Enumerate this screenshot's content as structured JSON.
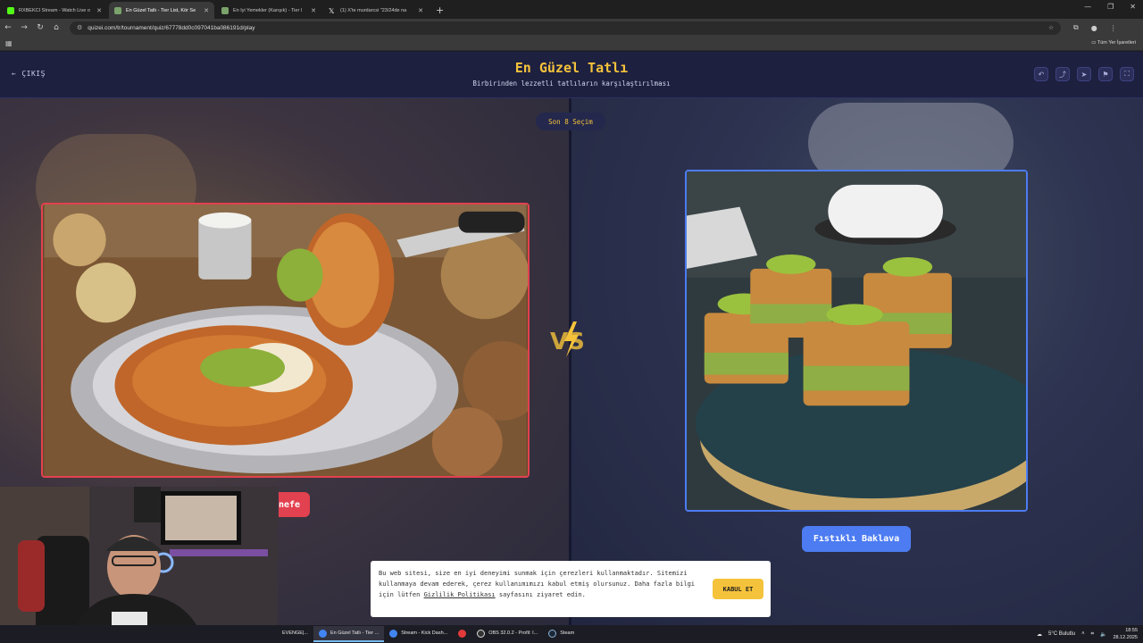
{
  "browser": {
    "tabs": [
      {
        "title": "RXBEKCI Stream - Watch Live o",
        "active": false,
        "favicon_color": "#53fc18"
      },
      {
        "title": "En Güzel Tatlı - Tier List, Kör Se",
        "active": true,
        "favicon_color": "#7aa36b"
      },
      {
        "title": "En İyi Yemekler (Karışık) - Tier l",
        "active": false,
        "favicon_color": "#7aa36b"
      },
      {
        "title": "(1) X'te murdarcsi \"23/24de na",
        "active": false,
        "favicon_color": "#ffffff"
      }
    ],
    "url": "quizei.com/tr/tournament/quiz/67778dd0c097041ba086191d/play",
    "bookmarks_all": "Tüm Yer İşaretleri"
  },
  "header": {
    "exit_label": "ÇIKIŞ",
    "title": "En Güzel Tatlı",
    "subtitle": "Birbirinden lezzetli tatlıların karşılaştırılması",
    "icons": [
      "undo-icon",
      "share-icon",
      "send-icon",
      "flag-icon",
      "fullscreen-icon"
    ]
  },
  "arena": {
    "round_label": "Son 8 Seçim",
    "left": {
      "name": "nefe",
      "accent": "#e2414f"
    },
    "right": {
      "name": "Fıstıklı Baklava",
      "accent": "#4d7cf2"
    }
  },
  "cookie": {
    "text_before": "Bu web sitesi, size en iyi deneyimi sunmak için çerezleri kullanmaktadır. Sitemizi kullanmaya devam ederek, çerez kullanımımızı kabul etmiş olursunuz. Daha fazla bilgi için lütfen ",
    "link": "Gizlilik Politikası",
    "text_after": " sayfasını ziyaret edin.",
    "button": "KABUL ET"
  },
  "taskbar": {
    "items": [
      {
        "label": "EVENGE|...",
        "active": false,
        "color": "#555"
      },
      {
        "label": "En Güzel Tatlı - Tier ...",
        "active": true,
        "color": "#4285f4"
      },
      {
        "label": "Stream - Kick Dash...",
        "active": false,
        "color": "#4285f4"
      },
      {
        "label": "",
        "active": false,
        "color": "#e23a3a"
      },
      {
        "label": "OBS 32.0.2 - Profil: I...",
        "active": false,
        "color": "#333"
      },
      {
        "label": "Steam",
        "active": false,
        "color": "#1b2838"
      }
    ],
    "weather": "5°C Bulutlu",
    "time": "18:55",
    "date": "28.12.2025"
  }
}
